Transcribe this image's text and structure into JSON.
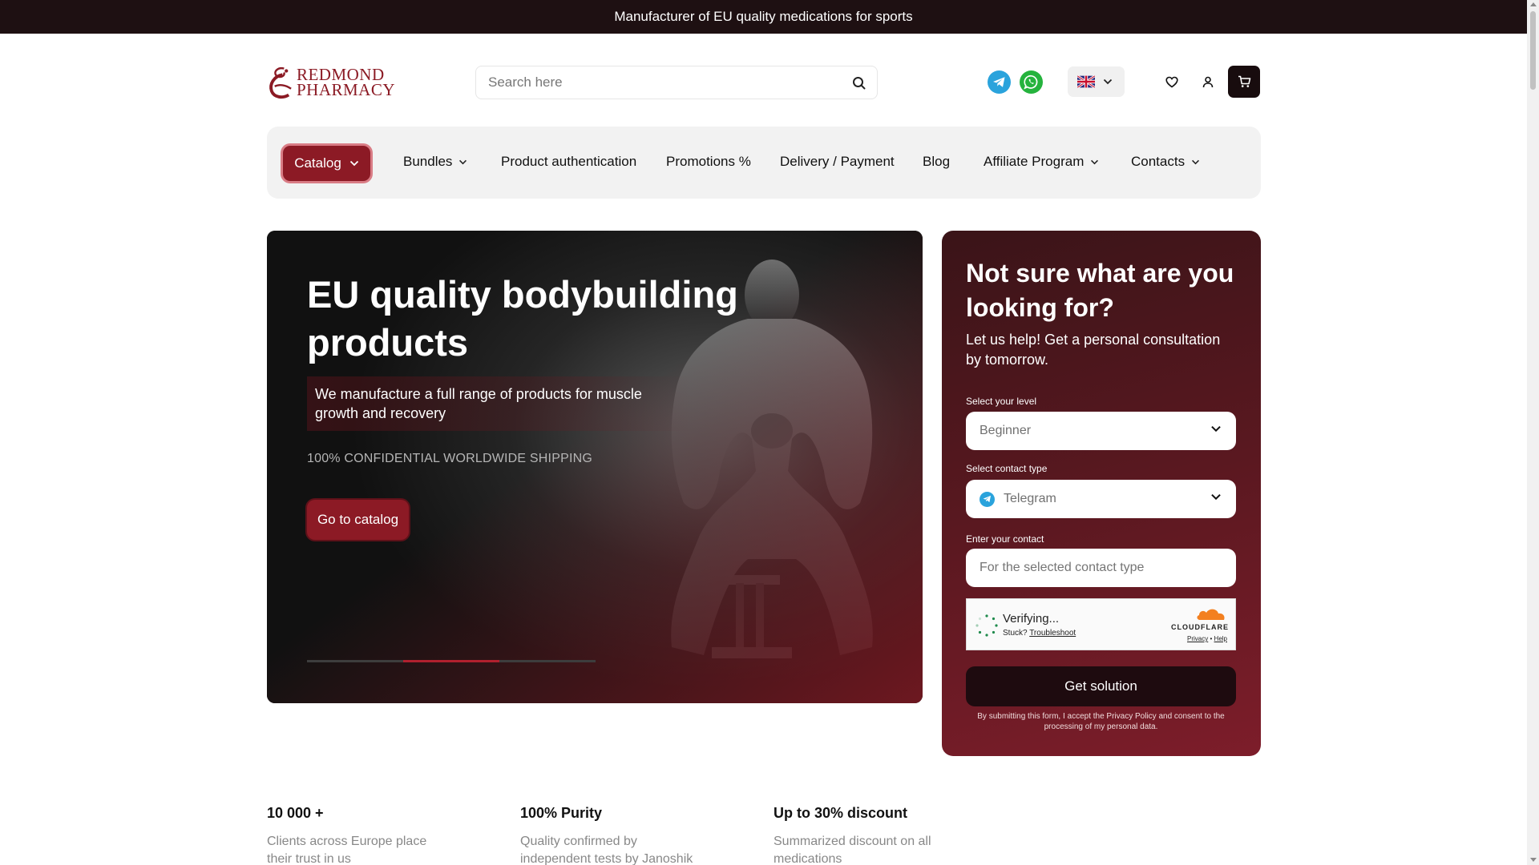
{
  "topbar": {
    "text": "Manufacturer of EU quality medications for sports"
  },
  "header": {
    "logo_line1": "REDMOND",
    "logo_line2": "PHARMACY",
    "search_placeholder": "Search here"
  },
  "nav": {
    "catalog": "Catalog",
    "items": [
      {
        "label": "Bundles",
        "has_dropdown": true
      },
      {
        "label": "Product authentication",
        "has_dropdown": false
      },
      {
        "label": "Promotions %",
        "has_dropdown": false
      },
      {
        "label": "Delivery / Payment",
        "has_dropdown": false
      },
      {
        "label": "Blog",
        "has_dropdown": false
      },
      {
        "label": "Affiliate Program",
        "has_dropdown": true
      },
      {
        "label": "Contacts",
        "has_dropdown": true
      }
    ]
  },
  "hero": {
    "title": "EU quality bodybuilding products",
    "subtitle": "We manufacture a full range of products for muscle growth and recovery",
    "shipping": "100% CONFIDENTIAL WORLDWIDE SHIPPING",
    "cta": "Go to catalog",
    "slider": {
      "slides": 3,
      "active": 2
    }
  },
  "consult": {
    "title": "Not sure what are you looking for?",
    "subtitle": "Let us help! Get a personal consultation by tomorrow.",
    "level_label": "Select your level",
    "level_value": "Beginner",
    "contact_type_label": "Select contact type",
    "contact_type_value": "Telegram",
    "contact_label": "Enter your contact",
    "contact_placeholder": "For the selected contact type",
    "captcha": {
      "status": "Verifying...",
      "stuck": "Stuck?",
      "troubleshoot": "Troubleshoot",
      "brand": "CLOUDFLARE",
      "privacy": "Privacy",
      "separator": "•",
      "help": "Help"
    },
    "submit": "Get solution",
    "note": "By submitting this form, I accept the Privacy Policy and consent to the processing of my personal data."
  },
  "stats": [
    {
      "title": "10 000 +",
      "desc": "Clients across Europe place their trust in us"
    },
    {
      "title": "100% Purity",
      "desc": "Quality confirmed by independent tests by Janoshik"
    },
    {
      "title": "Up to 30% discount",
      "desc": "Summarized discount on all medications"
    }
  ],
  "colors": {
    "brand": "#8c1a25",
    "topbar": "#1e1012",
    "telegram": "#2aa3dc",
    "whatsapp": "#25b33d"
  }
}
